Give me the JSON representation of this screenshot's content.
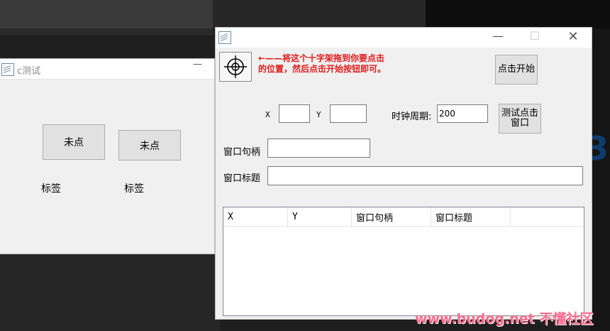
{
  "left_window": {
    "title": "c测试",
    "min_glyph": "—",
    "button1": "未点",
    "button2": "未点",
    "label1": "标签",
    "label2": "标签"
  },
  "right_window": {
    "controls": {
      "minimize": "—",
      "maximize": "☐",
      "close": "✕"
    },
    "instruction_line1": "←——将这个十字架拖到你要点击",
    "instruction_line2": "的位置，然后点击开始按钮即可。",
    "start_button": "点击开始",
    "x_label": "X",
    "y_label": "Y",
    "x_value": "",
    "y_value": "",
    "clock_label": "时钟周期:",
    "clock_value": "200",
    "test_button_line1": "测试点击",
    "test_button_line2": "窗口",
    "handle_label": "窗口句柄",
    "handle_value": "",
    "title_label": "窗口标题",
    "title_value": "",
    "list_columns": [
      "X",
      "Y",
      "窗口句柄",
      "窗口标题"
    ]
  },
  "watermark": "www.budog.net 不懂社区",
  "colors": {
    "instruction_red": "#e21b1b",
    "watermark_pink": "#ff6d8e"
  }
}
